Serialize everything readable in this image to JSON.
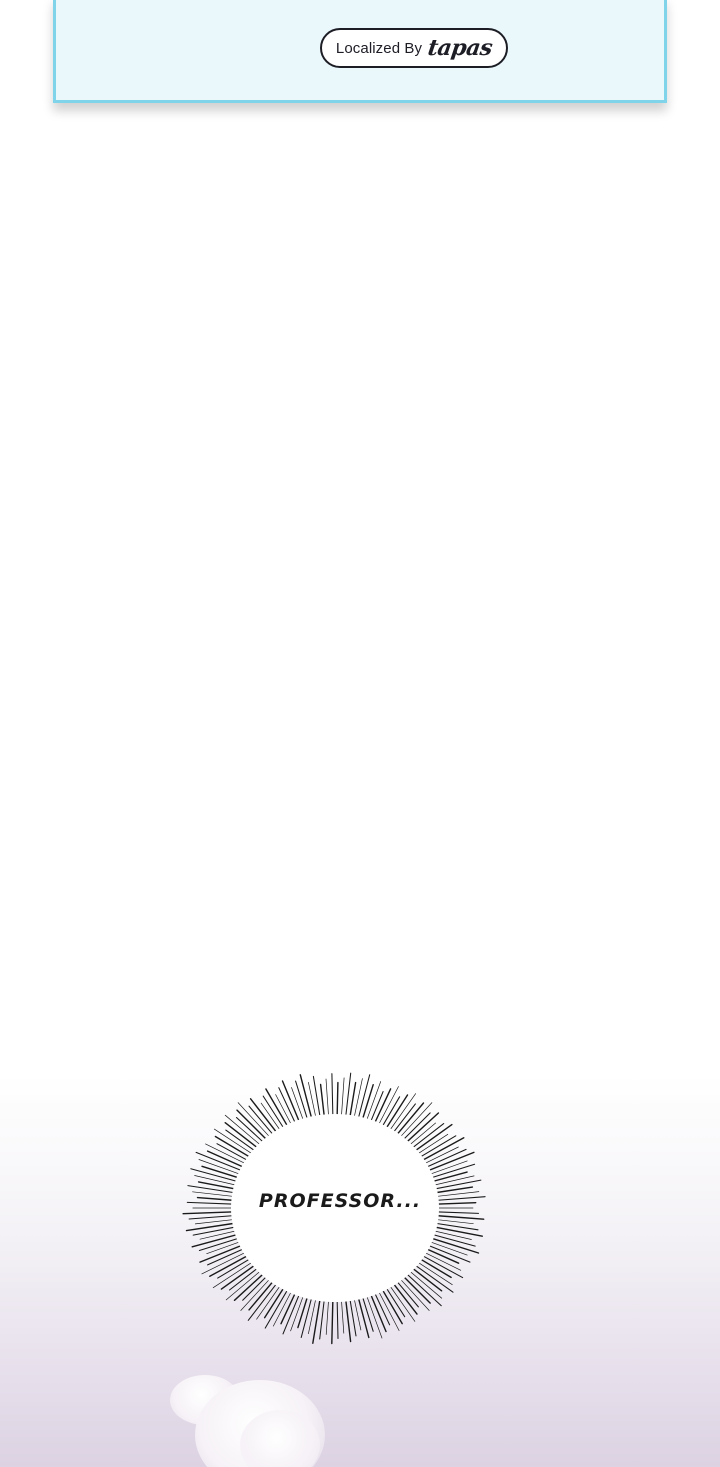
{
  "credit": {
    "prefix": "Localized By",
    "brand": "tapas"
  },
  "speech_bubble": {
    "text": "PROFESSOR..."
  },
  "colors": {
    "credit_panel_bg": "#eaf8fc",
    "credit_panel_border": "#7fd4ea",
    "ink": "#1d1d26",
    "scene_tint": "#e7e0ec"
  }
}
